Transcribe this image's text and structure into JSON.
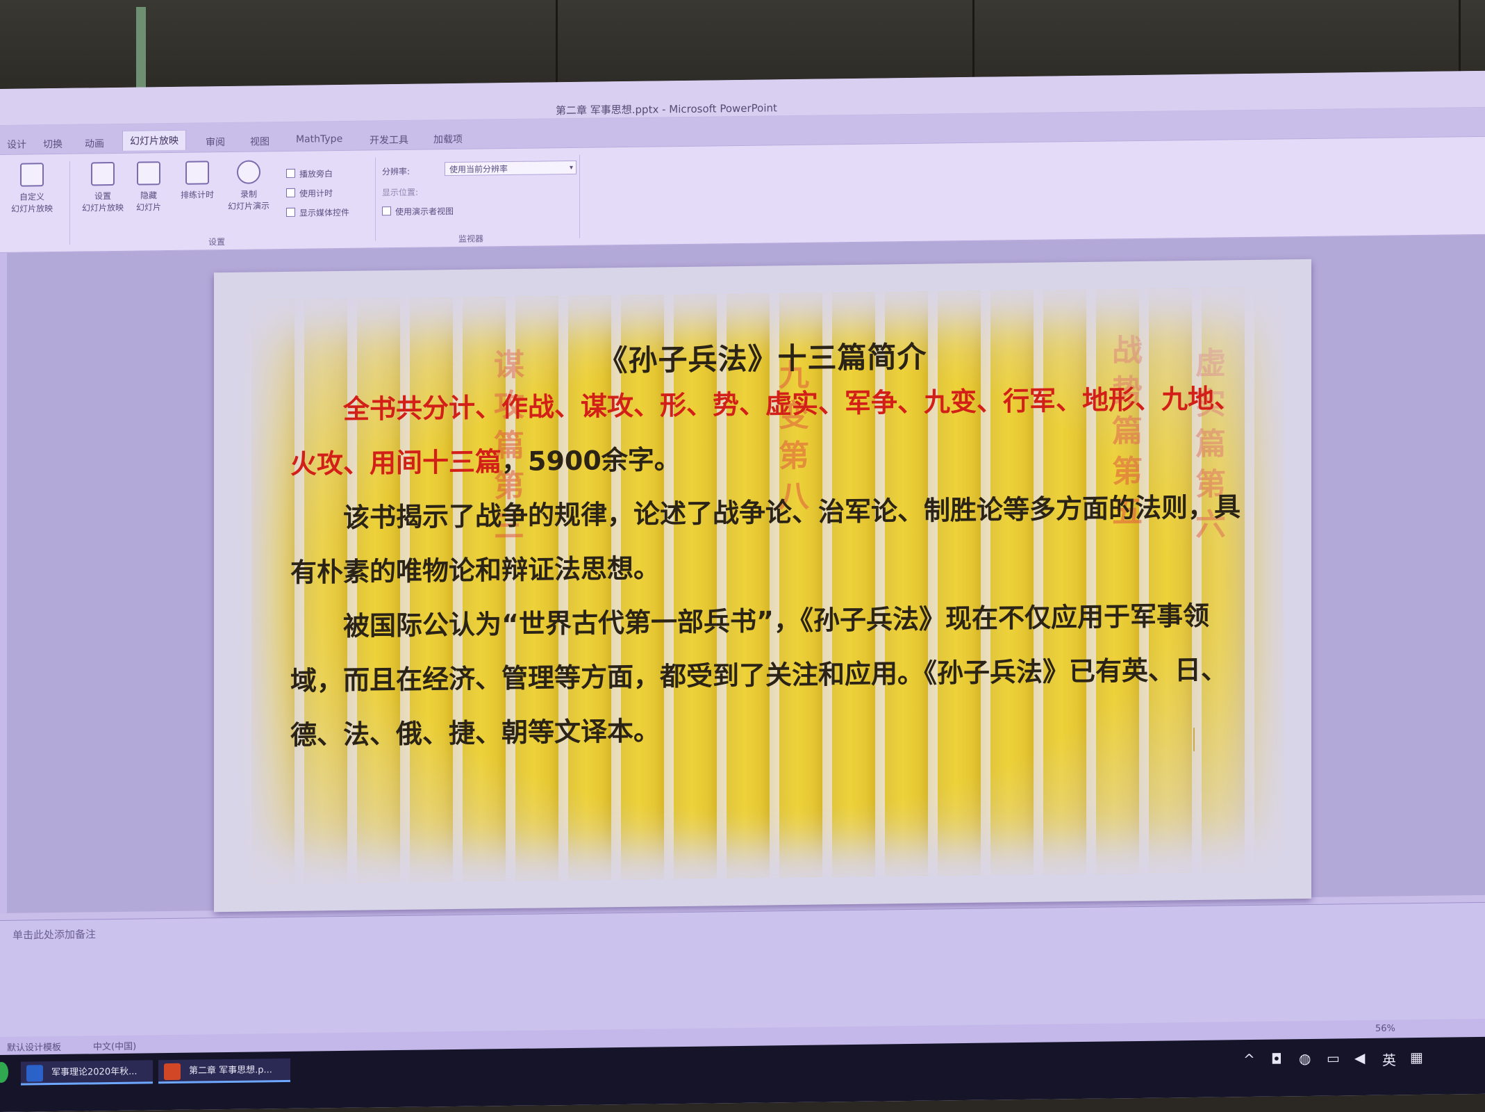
{
  "window": {
    "title": "第二章 军事思想.pptx - Microsoft PowerPoint"
  },
  "ribbon": {
    "tabs": [
      "设计",
      "切换",
      "动画",
      "幻灯片放映",
      "审阅",
      "视图",
      "MathType",
      "开发工具",
      "加载项"
    ],
    "active_tab": "幻灯片放映",
    "buttons": {
      "custom_show": "自定义\n幻灯片放映",
      "setup_show": "设置\n幻灯片放映",
      "hide_slide": "隐藏\n幻灯片",
      "rehearse": "排练计时",
      "record": "录制\n幻灯片演示"
    },
    "checkboxes": {
      "play_narrations": "播放旁白",
      "use_timings": "使用计时",
      "show_media_controls": "显示媒体控件",
      "use_presenter_view": "使用演示者视图"
    },
    "resolution_label": "分辨率:",
    "resolution_value": "使用当前分辨率",
    "show_on_label": "显示位置:",
    "group_setup": "设置",
    "group_monitors": "监视器"
  },
  "slide": {
    "title": "《孙子兵法》十三篇简介",
    "para1_red": "全书共分计、作战、谋攻、形、势、虚实、军争、九变、行军、地形、九地、火攻、用间十三篇",
    "para1_rest": "，5900余字。",
    "para2": "该书揭示了战争的规律，论述了战争论、治军论、制胜论等多方面的法则，具有朴素的唯物论和辩证法思想。",
    "para3": "被国际公认为“世界古代第一部兵书”，《孙子兵法》现在不仅应用于军事领域，而且在经济、管理等方面，都受到了关注和应用。《孙子兵法》已有英、日、德、法、俄、捷、朝等文译本。"
  },
  "notes": {
    "placeholder": "单击此处添加备注"
  },
  "status": {
    "theme": "默认设计模板",
    "language": "中文(中国)",
    "zoom": "56%"
  },
  "taskbar": {
    "items": [
      "军事理论2020年秋...",
      "第二章 军事思想.p..."
    ]
  }
}
